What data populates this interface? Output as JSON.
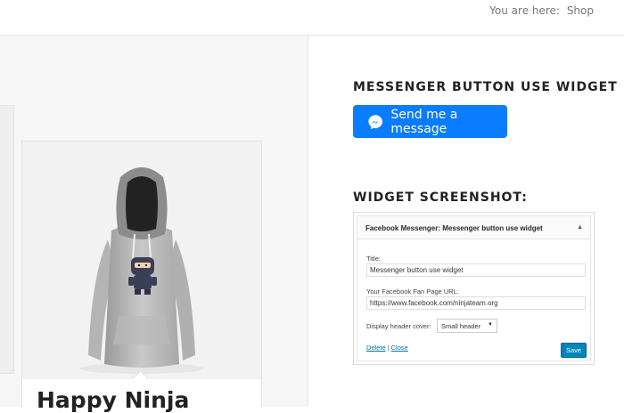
{
  "header": {
    "breadcrumb_prefix": "You are here:",
    "breadcrumb_current": "Shop"
  },
  "product": {
    "title": "Happy Ninja",
    "image": "hoodie-with-ninja-print"
  },
  "sidebar": {
    "widget1_title": "MESSENGER BUTTON USE WIDGET",
    "messenger_button_label": "Send me a message",
    "messenger_button_color": "#0a7cff",
    "widget2_title": "WIDGET SCREENSHOT:"
  },
  "screenshot": {
    "header": "Facebook Messenger: Messenger button use widget",
    "title_label": "Title:",
    "title_value": "Messenger button use widget",
    "url_label": "Your Facebook Fan Page URL:",
    "url_value": "https://www.facebook.com/ninjateam.org",
    "cover_label": "Display header cover:",
    "cover_value": "Small header",
    "delete_label": "Delete",
    "separator": "|",
    "close_label": "Close",
    "save_label": "Save"
  }
}
